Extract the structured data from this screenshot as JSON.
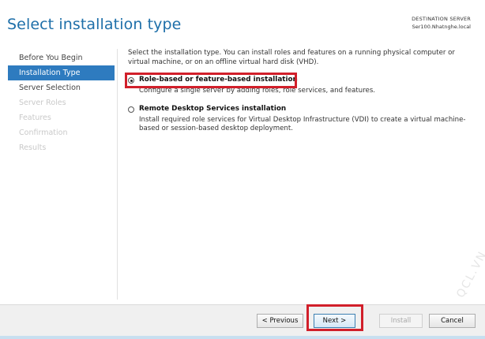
{
  "header": {
    "title": "Select installation type",
    "destination_label": "DESTINATION SERVER",
    "destination_server": "Ser100.Nhatnghe.local"
  },
  "nav": {
    "items": [
      {
        "label": "Before You Begin",
        "state": "normal"
      },
      {
        "label": "Installation Type",
        "state": "active"
      },
      {
        "label": "Server Selection",
        "state": "normal"
      },
      {
        "label": "Server Roles",
        "state": "disabled"
      },
      {
        "label": "Features",
        "state": "disabled"
      },
      {
        "label": "Confirmation",
        "state": "disabled"
      },
      {
        "label": "Results",
        "state": "disabled"
      }
    ]
  },
  "content": {
    "intro": "Select the installation type. You can install roles and features on a running physical computer or virtual machine, or on an offline virtual hard disk (VHD).",
    "options": [
      {
        "label": "Role-based or feature-based installation",
        "description": "Configure a single server by adding roles, role services, and features.",
        "selected": true
      },
      {
        "label": "Remote Desktop Services installation",
        "description": "Install required role services for Virtual Desktop Infrastructure (VDI) to create a virtual machine-based or session-based desktop deployment.",
        "selected": false
      }
    ]
  },
  "footer": {
    "previous_label": "< Previous",
    "next_label": "Next >",
    "install_label": "Install",
    "cancel_label": "Cancel"
  },
  "watermark": "QCL.VN",
  "colors": {
    "title": "#1e6fa9",
    "nav_active": "#2e7bbf",
    "highlight": "#d11f2a"
  }
}
